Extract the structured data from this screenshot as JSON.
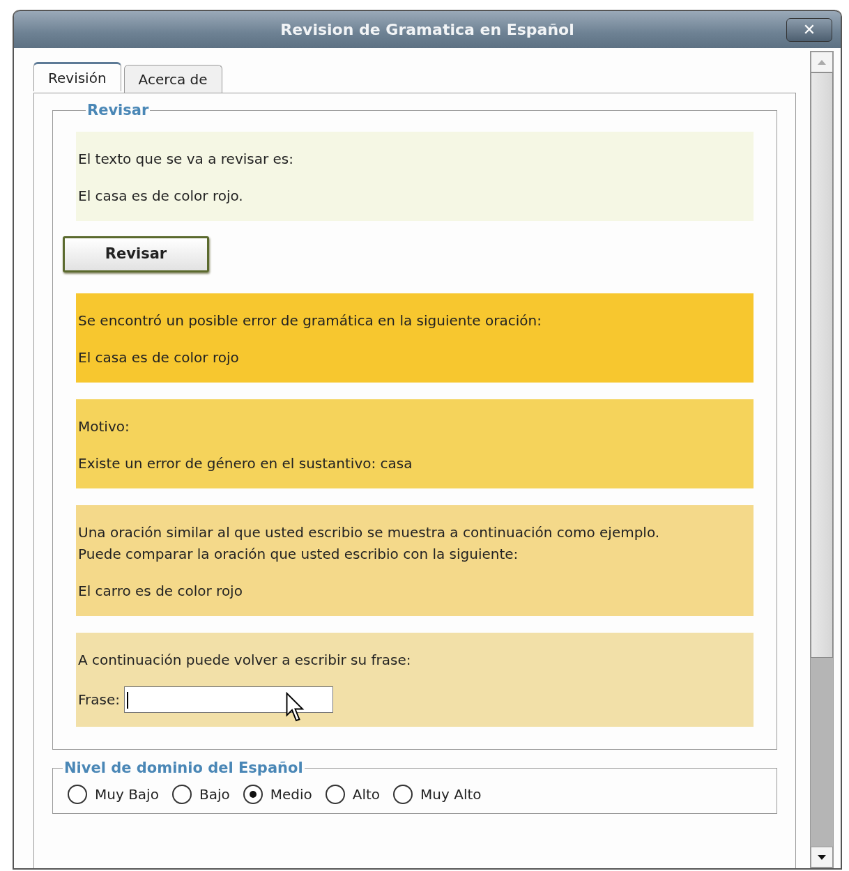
{
  "window": {
    "title": "Revision de Gramatica en Español",
    "close": "✕"
  },
  "tabs": [
    {
      "label": "Revisión",
      "selected": true
    },
    {
      "label": "Acerca de",
      "selected": false
    }
  ],
  "review": {
    "legend": "Revisar",
    "button": "Revisar",
    "panels": [
      {
        "kind": "text",
        "color": "#f5f7e4",
        "paragraphs": [
          [
            "El texto que se va a revisar es:"
          ],
          [
            "El casa es de color rojo."
          ]
        ]
      },
      {
        "kind": "button"
      },
      {
        "kind": "text",
        "color": "#f7c72f",
        "paragraphs": [
          [
            "Se encontró un posible error de gramática en la siguiente oración:"
          ],
          [
            "El casa es de color rojo"
          ]
        ]
      },
      {
        "kind": "text",
        "color": "#f5d35b",
        "paragraphs": [
          [
            "Motivo:"
          ],
          [
            "Existe un error de género en el sustantivo: casa"
          ]
        ]
      },
      {
        "kind": "text",
        "color": "#f4d98a",
        "paragraphs": [
          [
            "Una oración similar al que usted escribio se muestra a continuación como ejemplo.",
            "Puede comparar la oración que usted escribio con la siguiente:"
          ],
          [
            "El carro es de color rojo"
          ]
        ]
      },
      {
        "kind": "form",
        "color": "#f2e0a8",
        "paragraphs": [
          [
            "A continuación puede volver a escribir su frase:"
          ]
        ],
        "field_label": "Frase:"
      }
    ]
  },
  "level": {
    "legend": "Nivel de dominio del Español",
    "options": [
      {
        "label": "Muy Bajo",
        "selected": false
      },
      {
        "label": "Bajo",
        "selected": false
      },
      {
        "label": "Medio",
        "selected": true
      },
      {
        "label": "Alto",
        "selected": false
      },
      {
        "label": "Muy Alto",
        "selected": false
      }
    ]
  }
}
